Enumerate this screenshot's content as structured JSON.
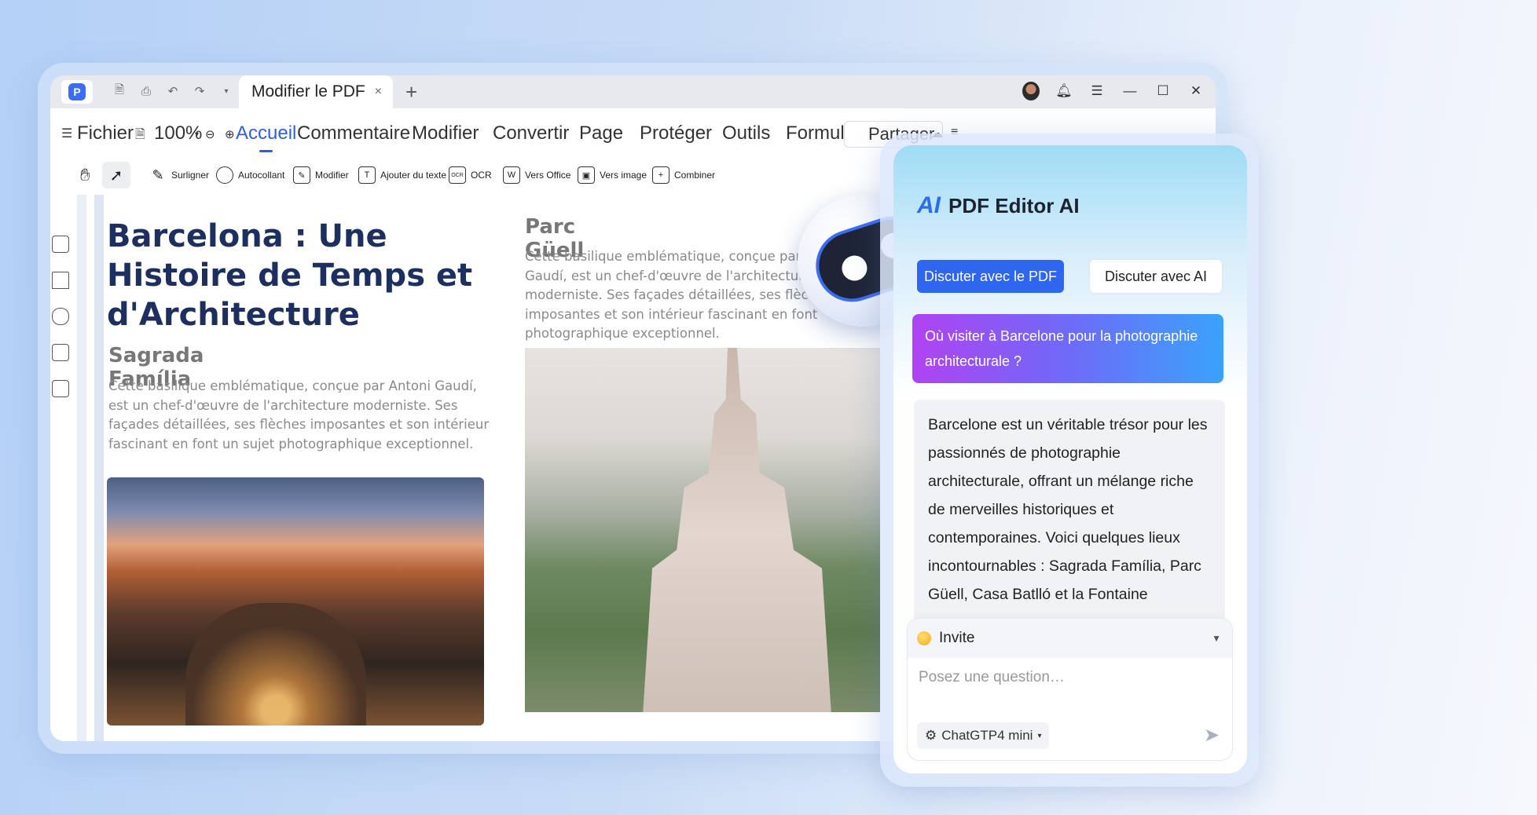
{
  "window": {
    "tab_title": "Modifier le PDF",
    "tab_close": "×",
    "new_tab": "+"
  },
  "menu": {
    "file": "Fichier",
    "zoom": "100%",
    "items": [
      "Accueil",
      "Commentaire",
      "Modifier",
      "Convertir",
      "Page",
      "Protéger",
      "Outils",
      "Formulaires"
    ],
    "share": "Partager"
  },
  "toolbar": {
    "items": [
      "Surligner",
      "Autocollant",
      "Modifier",
      "Ajouter du texte",
      "OCR",
      "Vers Office",
      "Vers image",
      "Combiner"
    ]
  },
  "document": {
    "title": "Barcelona : Une Histoire de Temps et d'Architecture",
    "section1_title": "Sagrada Família",
    "section1_text": "Cette basilique emblématique, conçue par Antoni Gaudí, est un chef-d'œuvre de l'architecture moderniste. Ses façades détaillées, ses flèches imposantes et son intérieur fascinant en font un sujet photographique exceptionnel.",
    "section2_title": "Parc Güell",
    "section2_lines": [
      "Cette basilique emblématique, conçue par",
      "Gaudí, est un chef-d'œuvre de l'architectur",
      "moderniste. Ses façades détaillées, ses flèc",
      "imposantes et son intérieur fascinant en font",
      "photographique exceptionnel."
    ]
  },
  "ai_panel": {
    "logo": "AI",
    "title": "PDF Editor AI",
    "tab_pdf": "Discuter avec le PDF",
    "tab_ai": "Discuter avec AI",
    "question": "Où visiter à Barcelone pour la photographie architecturale ?",
    "answer": "Barcelone est un véritable trésor pour les passionnés de photographie architecturale, offrant un mélange riche de merveilles historiques et contemporaines. Voici quelques lieux incontournables : Sagrada Família, Parc Güell, Casa Batlló et la Fontaine",
    "prompt_label": "Invite",
    "input_placeholder": "Posez une question…",
    "model": "ChatGTP4 mini"
  },
  "colors": {
    "accent": "#2f66f0",
    "title_navy": "#1d2f5f"
  }
}
